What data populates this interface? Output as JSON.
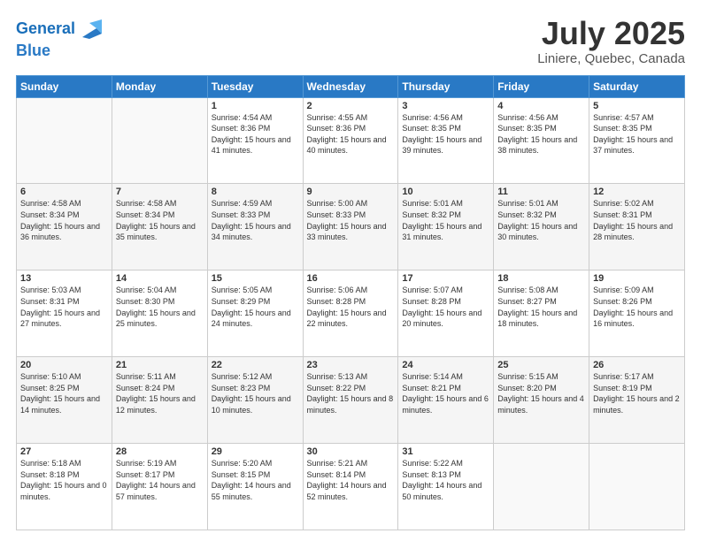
{
  "header": {
    "logo_line1": "General",
    "logo_line2": "Blue",
    "title": "July 2025",
    "subtitle": "Liniere, Quebec, Canada"
  },
  "weekdays": [
    "Sunday",
    "Monday",
    "Tuesday",
    "Wednesday",
    "Thursday",
    "Friday",
    "Saturday"
  ],
  "weeks": [
    [
      {
        "day": "",
        "sunrise": "",
        "sunset": "",
        "daylight": ""
      },
      {
        "day": "",
        "sunrise": "",
        "sunset": "",
        "daylight": ""
      },
      {
        "day": "1",
        "sunrise": "Sunrise: 4:54 AM",
        "sunset": "Sunset: 8:36 PM",
        "daylight": "Daylight: 15 hours and 41 minutes."
      },
      {
        "day": "2",
        "sunrise": "Sunrise: 4:55 AM",
        "sunset": "Sunset: 8:36 PM",
        "daylight": "Daylight: 15 hours and 40 minutes."
      },
      {
        "day": "3",
        "sunrise": "Sunrise: 4:56 AM",
        "sunset": "Sunset: 8:35 PM",
        "daylight": "Daylight: 15 hours and 39 minutes."
      },
      {
        "day": "4",
        "sunrise": "Sunrise: 4:56 AM",
        "sunset": "Sunset: 8:35 PM",
        "daylight": "Daylight: 15 hours and 38 minutes."
      },
      {
        "day": "5",
        "sunrise": "Sunrise: 4:57 AM",
        "sunset": "Sunset: 8:35 PM",
        "daylight": "Daylight: 15 hours and 37 minutes."
      }
    ],
    [
      {
        "day": "6",
        "sunrise": "Sunrise: 4:58 AM",
        "sunset": "Sunset: 8:34 PM",
        "daylight": "Daylight: 15 hours and 36 minutes."
      },
      {
        "day": "7",
        "sunrise": "Sunrise: 4:58 AM",
        "sunset": "Sunset: 8:34 PM",
        "daylight": "Daylight: 15 hours and 35 minutes."
      },
      {
        "day": "8",
        "sunrise": "Sunrise: 4:59 AM",
        "sunset": "Sunset: 8:33 PM",
        "daylight": "Daylight: 15 hours and 34 minutes."
      },
      {
        "day": "9",
        "sunrise": "Sunrise: 5:00 AM",
        "sunset": "Sunset: 8:33 PM",
        "daylight": "Daylight: 15 hours and 33 minutes."
      },
      {
        "day": "10",
        "sunrise": "Sunrise: 5:01 AM",
        "sunset": "Sunset: 8:32 PM",
        "daylight": "Daylight: 15 hours and 31 minutes."
      },
      {
        "day": "11",
        "sunrise": "Sunrise: 5:01 AM",
        "sunset": "Sunset: 8:32 PM",
        "daylight": "Daylight: 15 hours and 30 minutes."
      },
      {
        "day": "12",
        "sunrise": "Sunrise: 5:02 AM",
        "sunset": "Sunset: 8:31 PM",
        "daylight": "Daylight: 15 hours and 28 minutes."
      }
    ],
    [
      {
        "day": "13",
        "sunrise": "Sunrise: 5:03 AM",
        "sunset": "Sunset: 8:31 PM",
        "daylight": "Daylight: 15 hours and 27 minutes."
      },
      {
        "day": "14",
        "sunrise": "Sunrise: 5:04 AM",
        "sunset": "Sunset: 8:30 PM",
        "daylight": "Daylight: 15 hours and 25 minutes."
      },
      {
        "day": "15",
        "sunrise": "Sunrise: 5:05 AM",
        "sunset": "Sunset: 8:29 PM",
        "daylight": "Daylight: 15 hours and 24 minutes."
      },
      {
        "day": "16",
        "sunrise": "Sunrise: 5:06 AM",
        "sunset": "Sunset: 8:28 PM",
        "daylight": "Daylight: 15 hours and 22 minutes."
      },
      {
        "day": "17",
        "sunrise": "Sunrise: 5:07 AM",
        "sunset": "Sunset: 8:28 PM",
        "daylight": "Daylight: 15 hours and 20 minutes."
      },
      {
        "day": "18",
        "sunrise": "Sunrise: 5:08 AM",
        "sunset": "Sunset: 8:27 PM",
        "daylight": "Daylight: 15 hours and 18 minutes."
      },
      {
        "day": "19",
        "sunrise": "Sunrise: 5:09 AM",
        "sunset": "Sunset: 8:26 PM",
        "daylight": "Daylight: 15 hours and 16 minutes."
      }
    ],
    [
      {
        "day": "20",
        "sunrise": "Sunrise: 5:10 AM",
        "sunset": "Sunset: 8:25 PM",
        "daylight": "Daylight: 15 hours and 14 minutes."
      },
      {
        "day": "21",
        "sunrise": "Sunrise: 5:11 AM",
        "sunset": "Sunset: 8:24 PM",
        "daylight": "Daylight: 15 hours and 12 minutes."
      },
      {
        "day": "22",
        "sunrise": "Sunrise: 5:12 AM",
        "sunset": "Sunset: 8:23 PM",
        "daylight": "Daylight: 15 hours and 10 minutes."
      },
      {
        "day": "23",
        "sunrise": "Sunrise: 5:13 AM",
        "sunset": "Sunset: 8:22 PM",
        "daylight": "Daylight: 15 hours and 8 minutes."
      },
      {
        "day": "24",
        "sunrise": "Sunrise: 5:14 AM",
        "sunset": "Sunset: 8:21 PM",
        "daylight": "Daylight: 15 hours and 6 minutes."
      },
      {
        "day": "25",
        "sunrise": "Sunrise: 5:15 AM",
        "sunset": "Sunset: 8:20 PM",
        "daylight": "Daylight: 15 hours and 4 minutes."
      },
      {
        "day": "26",
        "sunrise": "Sunrise: 5:17 AM",
        "sunset": "Sunset: 8:19 PM",
        "daylight": "Daylight: 15 hours and 2 minutes."
      }
    ],
    [
      {
        "day": "27",
        "sunrise": "Sunrise: 5:18 AM",
        "sunset": "Sunset: 8:18 PM",
        "daylight": "Daylight: 15 hours and 0 minutes."
      },
      {
        "day": "28",
        "sunrise": "Sunrise: 5:19 AM",
        "sunset": "Sunset: 8:17 PM",
        "daylight": "Daylight: 14 hours and 57 minutes."
      },
      {
        "day": "29",
        "sunrise": "Sunrise: 5:20 AM",
        "sunset": "Sunset: 8:15 PM",
        "daylight": "Daylight: 14 hours and 55 minutes."
      },
      {
        "day": "30",
        "sunrise": "Sunrise: 5:21 AM",
        "sunset": "Sunset: 8:14 PM",
        "daylight": "Daylight: 14 hours and 52 minutes."
      },
      {
        "day": "31",
        "sunrise": "Sunrise: 5:22 AM",
        "sunset": "Sunset: 8:13 PM",
        "daylight": "Daylight: 14 hours and 50 minutes."
      },
      {
        "day": "",
        "sunrise": "",
        "sunset": "",
        "daylight": ""
      },
      {
        "day": "",
        "sunrise": "",
        "sunset": "",
        "daylight": ""
      }
    ]
  ]
}
